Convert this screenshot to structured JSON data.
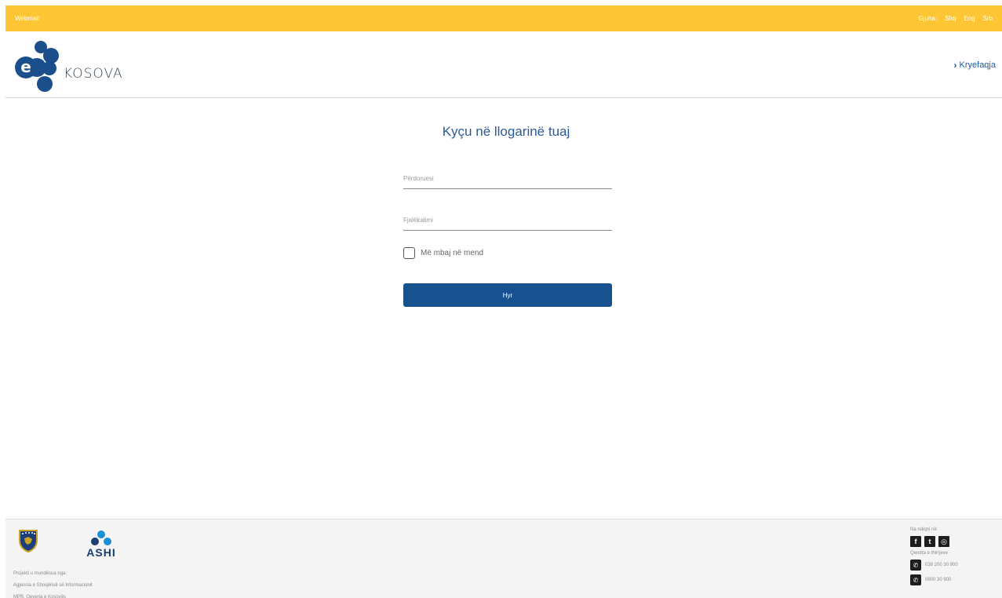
{
  "topbar": {
    "webmail": "Webmail",
    "languages": [
      "Gjuha:",
      "Shq",
      "Eng",
      "Srb"
    ],
    "color": "#fec634"
  },
  "header": {
    "logo_text": "KOSOVA",
    "home_link": "Kryefaqja"
  },
  "login": {
    "title": "Kyçu në llogarinë tuaj",
    "username_placeholder": "Përdoruesi",
    "password_placeholder": "Fjalëkalimi",
    "remember_label": "Më mbaj në mend",
    "submit_label": "Hyr",
    "button_color": "#17518f"
  },
  "footer": {
    "ashi_text": "ASHI",
    "lines": [
      "Projekti u mundësua nga:",
      "Agjencia e Shoqërisë së Informacionit",
      "MPB, Qeveria e Kosovës"
    ],
    "follow_label": "Na ndiqni në:",
    "social_icons": [
      "facebook-icon",
      "twitter-icon",
      "instagram-icon"
    ],
    "call_center_label": "Qendra e thirrjeve",
    "phones": [
      "038 200 30 900",
      "0800 30 900"
    ]
  }
}
